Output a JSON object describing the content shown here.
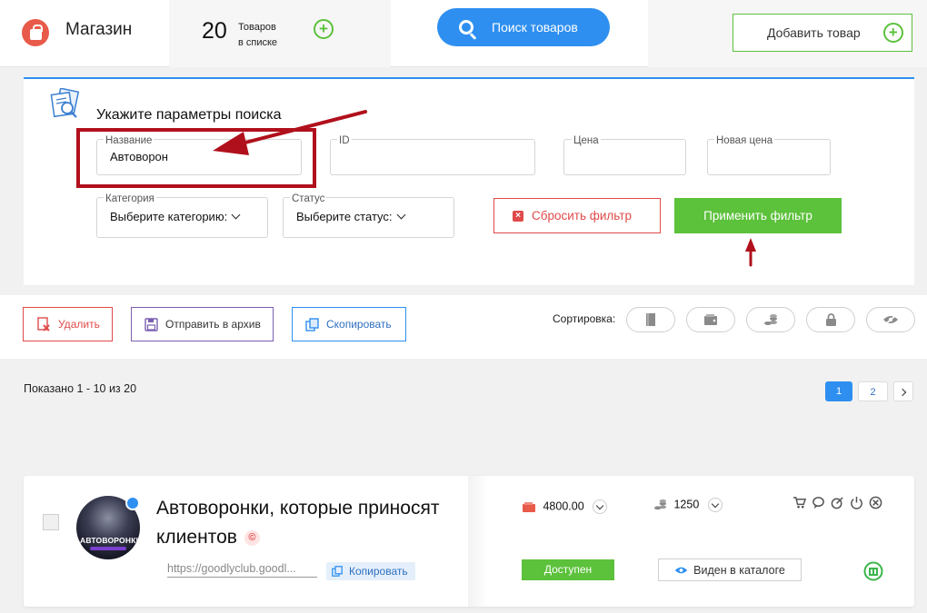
{
  "header": {
    "shop_title": "Магазин",
    "count": "20",
    "count_label_line1": "Товаров",
    "count_label_line2": "в списке",
    "search_button": "Поиск товаров",
    "add_button": "Добавить товар"
  },
  "search_panel": {
    "title": "Укажите параметры поиска",
    "fields": {
      "name": {
        "label": "Название",
        "value": "Автоворон"
      },
      "id": {
        "label": "ID",
        "value": ""
      },
      "price": {
        "label": "Цена",
        "value": ""
      },
      "new_price": {
        "label": "Новая цена",
        "value": ""
      },
      "category": {
        "label": "Категория",
        "value": "Выберите категорию:"
      },
      "status": {
        "label": "Статус",
        "value": "Выберите статус:"
      }
    },
    "reset_button": "Сбросить фильтр",
    "apply_button": "Применить фильтр"
  },
  "actions": {
    "delete": "Удалить",
    "archive": "Отправить в архив",
    "copy": "Скопировать",
    "sort_label": "Сортировка:"
  },
  "listing": {
    "shown": "Показано 1 - 10 из 20",
    "pages": [
      "1",
      "2"
    ],
    "current_page": "1"
  },
  "product": {
    "title": "Автоворонки, которые приносят клиентов",
    "avatar_text": "АВТОВОРОНКИ",
    "url": "https://goodlyclub.goodl...",
    "copy_label": "Копировать",
    "price": "4800.00",
    "stock": "1250",
    "status": "Доступен",
    "visibility": "Виден в каталоге"
  },
  "colors": {
    "accent_blue": "#2e8ff0",
    "accent_green": "#5cc13b",
    "accent_red": "#e04a4a",
    "annotation_red": "#b0101c"
  }
}
